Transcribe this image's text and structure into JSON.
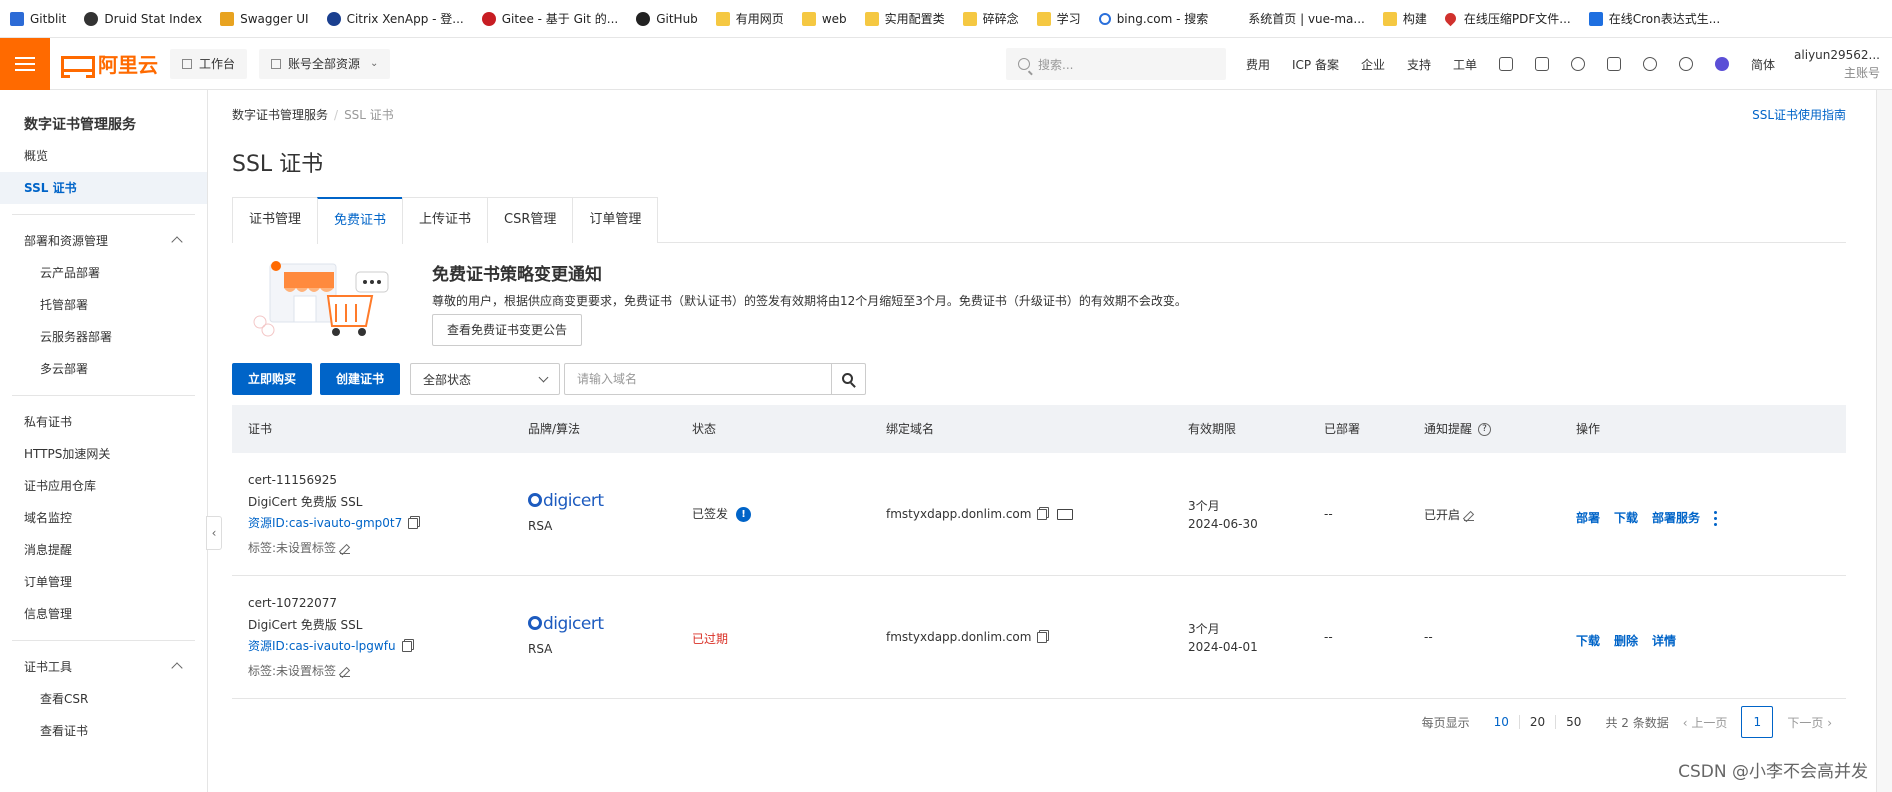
{
  "bookmarks": [
    {
      "label": "Gitblit",
      "icon": "blue"
    },
    {
      "label": "Druid Stat Index",
      "icon": "druid"
    },
    {
      "label": "Swagger UI",
      "icon": "swag"
    },
    {
      "label": "Citrix XenApp - 登...",
      "icon": "citrix"
    },
    {
      "label": "Gitee - 基于 Git 的...",
      "icon": "gitee"
    },
    {
      "label": "GitHub",
      "icon": "gh"
    },
    {
      "label": "有用网页",
      "icon": "folder"
    },
    {
      "label": "web",
      "icon": "folder"
    },
    {
      "label": "实用配置类",
      "icon": "folder"
    },
    {
      "label": "碎碎念",
      "icon": "folder"
    },
    {
      "label": "学习",
      "icon": "folder"
    },
    {
      "label": "bing.com - 搜索",
      "icon": "bing"
    },
    {
      "label": "系统首页 | vue-ma...",
      "icon": "lv"
    },
    {
      "label": "构建",
      "icon": "folder"
    },
    {
      "label": "在线压缩PDF文件...",
      "icon": "heart"
    },
    {
      "label": "在线Cron表达式生...",
      "icon": "tcron"
    }
  ],
  "header": {
    "logo_text": "阿里云",
    "workbench": "工作台",
    "resources": "账号全部资源",
    "search_placeholder": "搜索...",
    "links": [
      "费用",
      "ICP 备案",
      "企业",
      "支持",
      "工单"
    ],
    "lang": "简体",
    "user_name": "aliyun29562...",
    "user_sub": "主账号"
  },
  "sidebar": {
    "title": "数字证书管理服务",
    "items": [
      "概览",
      "SSL 证书"
    ],
    "group1": "部署和资源管理",
    "group1_items": [
      "云产品部署",
      "托管部署",
      "云服务器部署",
      "多云部署"
    ],
    "items2": [
      "私有证书",
      "HTTPS加速网关",
      "证书应用仓库",
      "域名监控",
      "消息提醒",
      "订单管理",
      "信息管理"
    ],
    "group2": "证书工具",
    "group2_items": [
      "查看CSR",
      "查看证书"
    ]
  },
  "main": {
    "breadcrumb_root": "数字证书管理服务",
    "breadcrumb_current": "SSL 证书",
    "guide_link": "SSL证书使用指南",
    "title": "SSL 证书",
    "tabs": [
      "证书管理",
      "免费证书",
      "上传证书",
      "CSR管理",
      "订单管理"
    ],
    "active_tab": "免费证书",
    "notice_title": "免费证书策略变更通知",
    "notice_desc": "尊敬的用户，根据供应商变更要求，免费证书（默认证书）的签发有效期将由12个月缩短至3个月。免费证书（升级证书）的有效期不会改变。",
    "notice_button": "查看免费证书变更公告",
    "buy_button": "立即购买",
    "create_button": "创建证书",
    "status_select": "全部状态",
    "domain_placeholder": "请输入域名"
  },
  "table": {
    "headers": [
      "证书",
      "品牌/算法",
      "状态",
      "绑定域名",
      "有效期限",
      "已部署",
      "通知提醒",
      "操作"
    ],
    "rows": [
      {
        "id": "cert-11156925",
        "name": "DigiCert 免费版 SSL",
        "resource": "资源ID:cas-ivauto-gmp0t7",
        "tag": "标签:未设置标签",
        "brand": "digicert",
        "algo": "RSA",
        "status": "已签发",
        "domain": "fmstyxdapp.donlim.com",
        "validity": "3个月",
        "expire": "2024-06-30",
        "deployed": "--",
        "notify": "已开启",
        "actions": [
          "部署",
          "下载",
          "部署服务"
        ]
      },
      {
        "id": "cert-10722077",
        "name": "DigiCert 免费版 SSL",
        "resource": "资源ID:cas-ivauto-lpgwfu",
        "tag": "标签:未设置标签",
        "brand": "digicert",
        "algo": "RSA",
        "status": "已过期",
        "domain": "fmstyxdapp.donlim.com",
        "validity": "3个月",
        "expire": "2024-04-01",
        "deployed": "--",
        "notify": "--",
        "actions": [
          "下载",
          "删除",
          "详情"
        ]
      }
    ]
  },
  "pager": {
    "page_size_label": "每页显示",
    "sizes": [
      "10",
      "20",
      "50"
    ],
    "current_size": "10",
    "total": "共 2 条数据",
    "prev": "上一页",
    "next": "下一页",
    "current_page": "1"
  },
  "watermark": "CSDN @小李不会高并发",
  "colors": {
    "brand": "#ff6a00",
    "primary": "#0064c8",
    "danger": "#d93026"
  }
}
